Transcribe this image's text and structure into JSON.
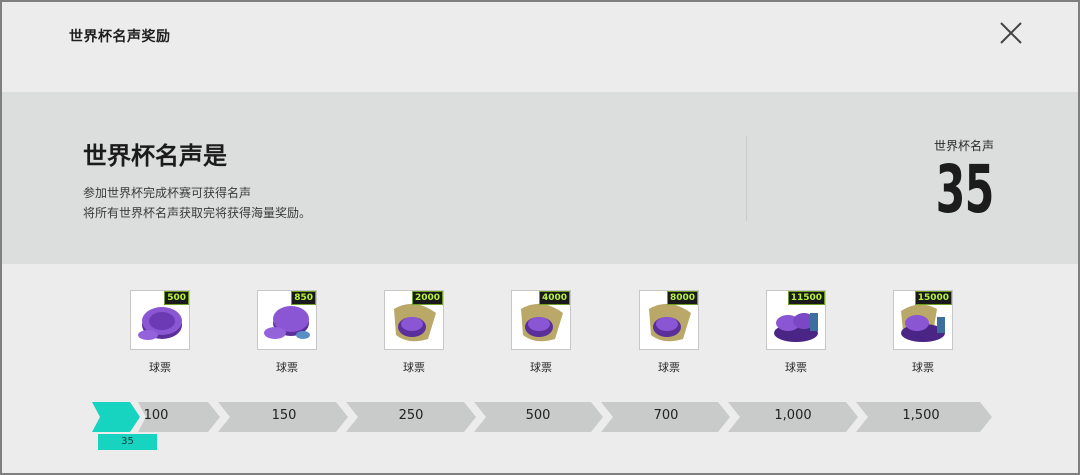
{
  "title": "世界杯名声奖励",
  "info": {
    "heading": "世界杯名声是",
    "desc_line1": "参加世界杯完成杯赛可获得名声",
    "desc_line2": "将所有世界杯名声获取完将获得海量奖励。",
    "fame_label": "世界杯名声",
    "fame_value": "35"
  },
  "rewards": [
    {
      "qty": "500",
      "label": "球票"
    },
    {
      "qty": "850",
      "label": "球票"
    },
    {
      "qty": "2000",
      "label": "球票"
    },
    {
      "qty": "4000",
      "label": "球票"
    },
    {
      "qty": "8000",
      "label": "球票"
    },
    {
      "qty": "11500",
      "label": "球票"
    },
    {
      "qty": "15000",
      "label": "球票"
    }
  ],
  "milestones": [
    "100",
    "150",
    "250",
    "500",
    "700",
    "1,000",
    "1,500"
  ],
  "current_progress": "35",
  "colors": {
    "accent": "#16d4bf",
    "qty_text": "#b7f23a",
    "track": "#c9cbca"
  }
}
